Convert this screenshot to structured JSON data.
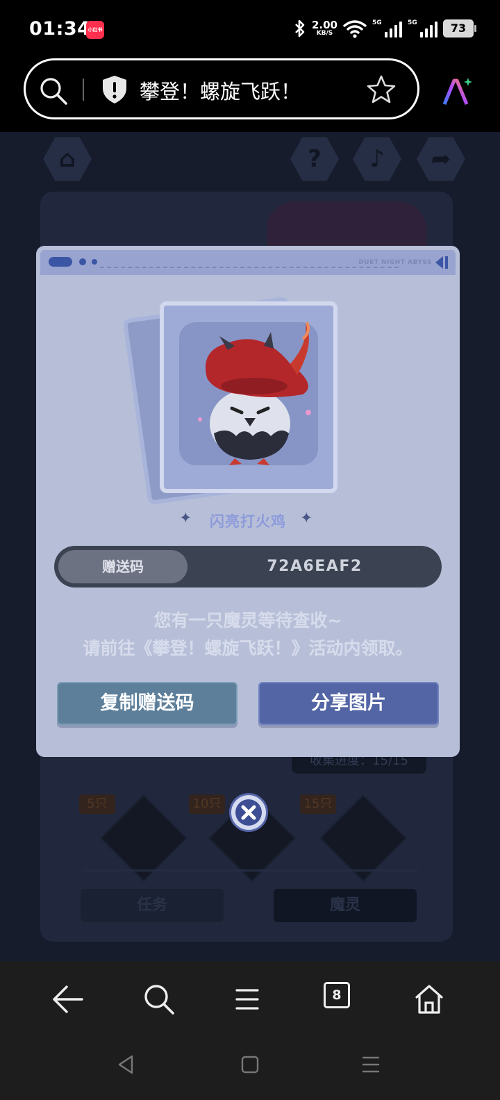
{
  "status_bar": {
    "time": "01:34",
    "app_badge": "小红书",
    "speed_value": "2.00",
    "speed_unit": "KB/S",
    "sim1": "5G",
    "sim2": "5G",
    "battery": "73"
  },
  "browser": {
    "page_title": "攀登！螺旋飞跃！"
  },
  "modal": {
    "brand": "DUET NIGHT ABYSS",
    "pet_name": "闪亮打火鸡",
    "code_label": "赠送码",
    "code_value": "72A6EAF2",
    "message_line1": "您有一只魔灵等待查收~",
    "message_line2": "请前往《攀登！螺旋飞跃！》活动内领取。",
    "copy_button": "复制赠送码",
    "share_button": "分享图片"
  },
  "background": {
    "progress_label": "收集进度：",
    "progress_value": "15/15",
    "milestones": [
      "5只",
      "10只",
      "15只"
    ],
    "tab_task": "任务",
    "tab_pet": "魔灵"
  },
  "navigation": {
    "tab_count": "8"
  },
  "icons": [
    "search-icon",
    "shield-icon",
    "star-icon",
    "ai-icon",
    "home-icon",
    "help-icon",
    "music-icon",
    "share-icon",
    "close-icon",
    "back-arrow-icon",
    "menu-icon",
    "tabs-icon",
    "triangle-back-icon",
    "square-home-icon",
    "recents-icon"
  ],
  "colors": {
    "modal_bg": "#b7bfd8",
    "code_bar": "#3b4252",
    "copy_button": "#5d7f9a",
    "share_button": "#5365a4"
  }
}
